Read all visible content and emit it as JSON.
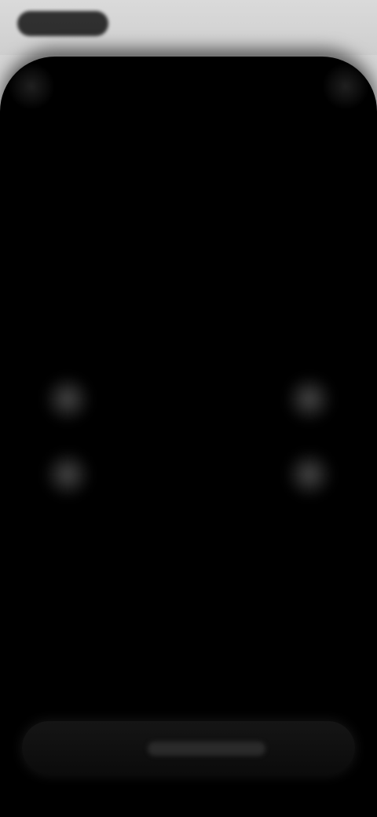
{
  "colors": {
    "top_bar": "#d0d0d0",
    "viewport": "#000000",
    "marker": "#5f5f5f",
    "bottom_bar": "#111111"
  },
  "icons": {
    "status": "status-pill-icon",
    "scan_frame": "scanner-corner-icon",
    "home": "home-indicator-icon"
  }
}
